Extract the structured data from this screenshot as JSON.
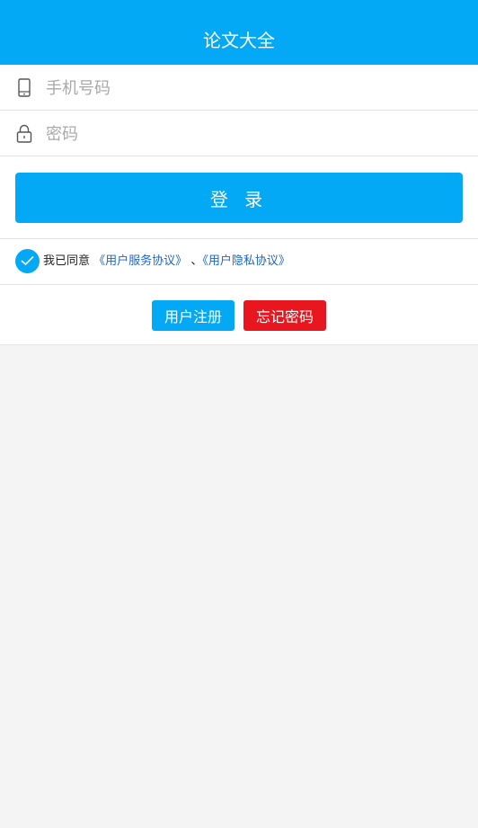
{
  "header": {
    "title": "论文大全"
  },
  "form": {
    "phone": {
      "placeholder": "手机号码",
      "value": "",
      "icon": "phone-icon"
    },
    "password": {
      "placeholder": "密码",
      "value": "",
      "icon": "lock-icon"
    },
    "login_label": "登 录"
  },
  "agreement": {
    "checked": true,
    "prefix": "我已同意",
    "service_link": "《用户服务协议》",
    "separator": "、",
    "privacy_link": "《用户隐私协议》"
  },
  "actions": {
    "register_label": "用户注册",
    "forgot_label": "忘记密码"
  },
  "colors": {
    "primary": "#03a9f4",
    "danger": "#e8171f",
    "link": "#1f64c8",
    "background": "#f4f4f4"
  }
}
